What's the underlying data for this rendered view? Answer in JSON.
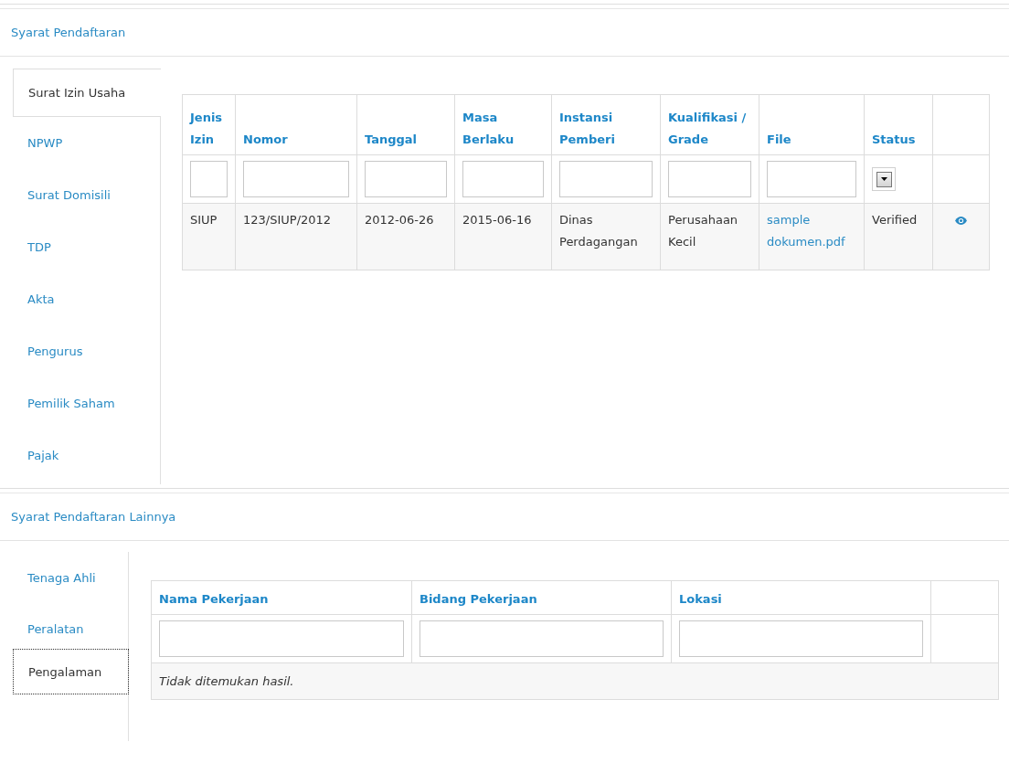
{
  "sections": [
    {
      "title": "Syarat Pendaftaran",
      "tabs": [
        {
          "label": "Surat Izin Usaha",
          "selected": true
        },
        {
          "label": "NPWP",
          "selected": false
        },
        {
          "label": "Surat Domisili",
          "selected": false
        },
        {
          "label": "TDP",
          "selected": false
        },
        {
          "label": "Akta",
          "selected": false
        },
        {
          "label": "Pengurus",
          "selected": false
        },
        {
          "label": "Pemilik Saham",
          "selected": false
        },
        {
          "label": "Pajak",
          "selected": false
        }
      ],
      "table": {
        "columns": [
          "Jenis Izin",
          "Nomor",
          "Tanggal",
          "Masa Berlaku",
          "Instansi Pemberi",
          "Kualifikasi / Grade",
          "File",
          "Status"
        ],
        "filters": [
          {
            "kind": "text"
          },
          {
            "kind": "text"
          },
          {
            "kind": "text"
          },
          {
            "kind": "text"
          },
          {
            "kind": "text"
          },
          {
            "kind": "text"
          },
          {
            "kind": "text"
          },
          {
            "kind": "select"
          }
        ],
        "rows": [
          {
            "cells": [
              {
                "kind": "text",
                "text": "SIUP"
              },
              {
                "kind": "text",
                "text": "123/SIUP/2012"
              },
              {
                "kind": "text",
                "text": "2012-06-26"
              },
              {
                "kind": "text",
                "text": "2015-06-16"
              },
              {
                "kind": "text",
                "text": "Dinas Perdagangan"
              },
              {
                "kind": "text",
                "text": "Perusahaan Kecil"
              },
              {
                "kind": "link",
                "text": "sample dokumen.pdf"
              },
              {
                "kind": "text",
                "text": "Verified"
              }
            ]
          }
        ]
      }
    },
    {
      "title": "Syarat Pendaftaran Lainnya",
      "tabs": [
        {
          "label": "Tenaga Ahli",
          "selected": false
        },
        {
          "label": "Peralatan",
          "selected": false
        },
        {
          "label": "Pengalaman",
          "selected": true
        }
      ],
      "table": {
        "columns": [
          "Nama Pekerjaan",
          "Bidang Pekerjaan",
          "Lokasi"
        ],
        "filters": [
          {
            "kind": "text"
          },
          {
            "kind": "text"
          },
          {
            "kind": "text"
          }
        ],
        "empty_message": "Tidak ditemukan hasil."
      }
    }
  ]
}
